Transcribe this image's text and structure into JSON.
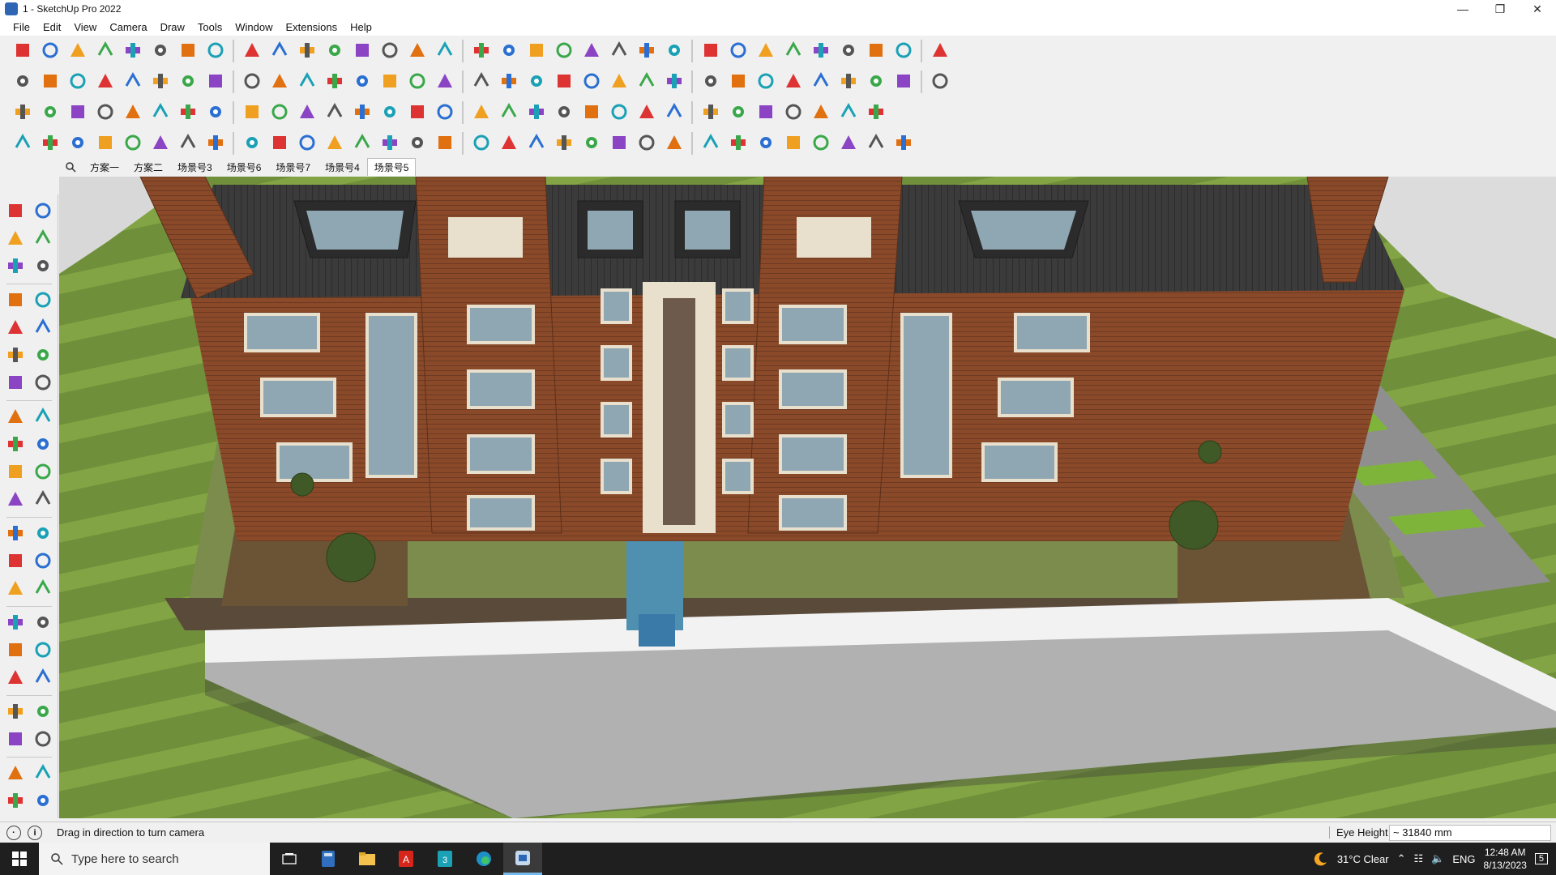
{
  "window": {
    "title": "1 - SketchUp Pro 2022",
    "controls": [
      "minimize",
      "maximize",
      "close"
    ]
  },
  "menu": [
    "File",
    "Edit",
    "View",
    "Camera",
    "Draw",
    "Tools",
    "Window",
    "Extensions",
    "Help"
  ],
  "toolbars": {
    "row1": [
      "zoom-extents",
      "select",
      "eraser",
      "line",
      "arc",
      "shape",
      "push-pull",
      "follow-me",
      "move",
      "rotate",
      "scale",
      "tape",
      "text",
      "paint",
      "orbit",
      "pan",
      "zoom",
      "zoom-window",
      "section",
      "shadow",
      "layers",
      "styles",
      "account",
      "component",
      "material",
      "scene",
      "up-down",
      "sort",
      "measure",
      "ruby",
      "undo",
      "redo",
      "warehouse"
    ],
    "row2": [
      "box",
      "view-iso",
      "view-top",
      "view-front",
      "view-right",
      "view-back",
      "view-left",
      "view-bottom",
      "xray",
      "wireframe",
      "hidden-line",
      "shaded",
      "textured",
      "monochrome",
      "house",
      "roof",
      "home",
      "bench",
      "gear",
      "hand",
      "pencil",
      "circle",
      "polygon",
      "ellipse",
      "rectangle",
      "rotated-rect",
      "freehand",
      "bezier",
      "solid",
      "paint2",
      "ruler",
      "ruler2",
      "sandbox"
    ],
    "row3": [
      "plane",
      "surface",
      "fill",
      "wand",
      "cut",
      "red-square",
      "list",
      "panel",
      "copy",
      "link",
      "curve",
      "cross",
      "multiply",
      "join",
      "triangle",
      "warn",
      "spiral",
      "arc2",
      "hook",
      "node",
      "cube",
      "ring",
      "redo2",
      "scale2",
      "gift",
      "calendar",
      "grid",
      "table",
      "plus",
      "dots",
      "tile"
    ],
    "row4": [
      "vertex",
      "path",
      "trim",
      "gear2",
      "loop",
      "drill",
      "elbow",
      "stair",
      "rail",
      "arc3",
      "beam",
      "step",
      "wave",
      "ramp",
      "hand2",
      "leaf",
      "wing",
      "ladder",
      "slope",
      "fence",
      "diag",
      "lines",
      "bars",
      "comb",
      "dome",
      "fan",
      "blocks",
      "stack",
      "branch",
      "cone",
      "arch",
      "mesh"
    ]
  },
  "scenes": {
    "tabs": [
      "方案一",
      "方案二",
      "场景号3",
      "场景号6",
      "场景号7",
      "场景号4",
      "场景号5"
    ],
    "active": "场景号5"
  },
  "status": {
    "message": "Drag in direction to turn camera",
    "measure_label": "Eye Height",
    "measure_value": "~ 31840 mm"
  },
  "taskbar": {
    "search_placeholder": "Type here to search",
    "apps": [
      "task-view",
      "calculator",
      "file-explorer",
      "acrobat",
      "app-3",
      "edge",
      "sketchup"
    ],
    "active_app": "sketchup",
    "weather": "31°C  Clear",
    "language": "ENG",
    "time": "12:48 AM",
    "date": "8/13/2023",
    "notifications": "5"
  },
  "colors": {
    "roof": "#3b3b3b",
    "brick": "#8a4a2a",
    "trim": "#e8dfcc",
    "lawn": "#6f8f3a",
    "ground": "#7d6a4e",
    "window_glass": "#8fa7b3"
  }
}
